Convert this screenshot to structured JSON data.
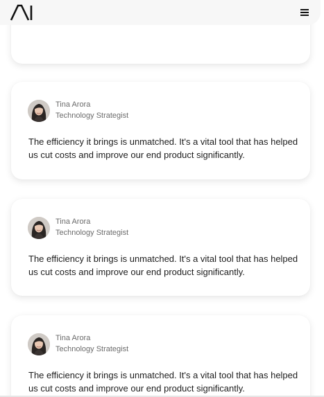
{
  "header": {
    "logo_text": "AI",
    "menu_icon": "hamburger-menu-icon"
  },
  "testimonials": [
    {
      "name": "Tina Arora",
      "role": "Technology Strategist",
      "quote": "The efficiency it brings is unmatched. It's a vital tool that has helped us cut costs and improve our end product significantly."
    },
    {
      "name": "Tina Arora",
      "role": "Technology Strategist",
      "quote": "The efficiency it brings is unmatched. It's a vital tool that has helped us cut costs and improve our end product significantly."
    },
    {
      "name": "Tina Arora",
      "role": "Technology Strategist",
      "quote": "The efficiency it brings is unmatched. It's a vital tool that has helped us cut costs and improve our end product significantly."
    }
  ],
  "colors": {
    "header_bg": "#f7f7f7",
    "text_primary": "#1c1c1c",
    "text_secondary": "#6b6b6b",
    "card_bg": "#ffffff"
  }
}
